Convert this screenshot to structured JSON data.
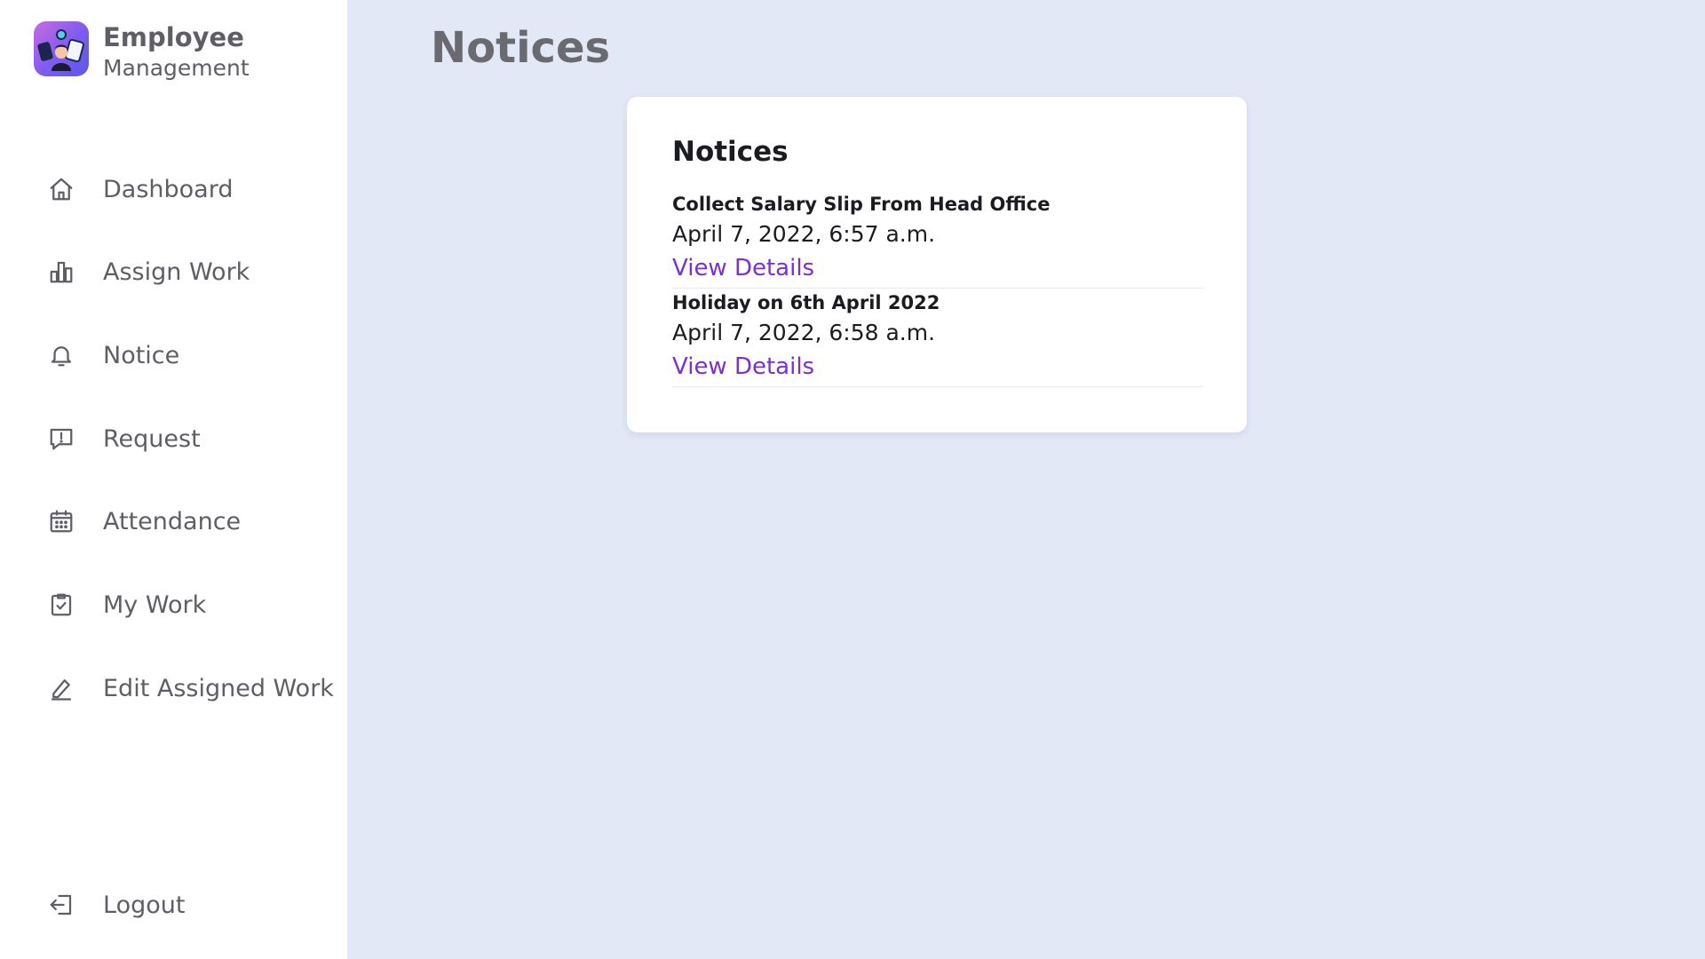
{
  "brand": {
    "title": "Employee",
    "subtitle": "Management",
    "icon": "employee-management-logo"
  },
  "sidebar": {
    "items": [
      {
        "label": "Dashboard",
        "icon": "home-icon"
      },
      {
        "label": "Assign Work",
        "icon": "bar-chart-icon"
      },
      {
        "label": "Notice",
        "icon": "bell-icon"
      },
      {
        "label": "Request",
        "icon": "message-alert-icon"
      },
      {
        "label": "Attendance",
        "icon": "calendar-icon"
      },
      {
        "label": "My Work",
        "icon": "clipboard-check-icon"
      },
      {
        "label": "Edit Assigned Work",
        "icon": "pencil-icon"
      }
    ],
    "logout": {
      "label": "Logout",
      "icon": "logout-icon"
    }
  },
  "page": {
    "title": "Notices"
  },
  "card": {
    "title": "Notices",
    "notices": [
      {
        "title": "Collect Salary Slip From Head Office",
        "date": "April 7, 2022, 6:57 a.m.",
        "link": "View Details"
      },
      {
        "title": "Holiday on 6th April 2022",
        "date": "April 7, 2022, 6:58 a.m.",
        "link": "View Details"
      }
    ]
  },
  "colors": {
    "background": "#e2e8f6",
    "sidebar": "#ffffff",
    "link": "#7b2fd6",
    "nav_text": "#5e5e66"
  }
}
